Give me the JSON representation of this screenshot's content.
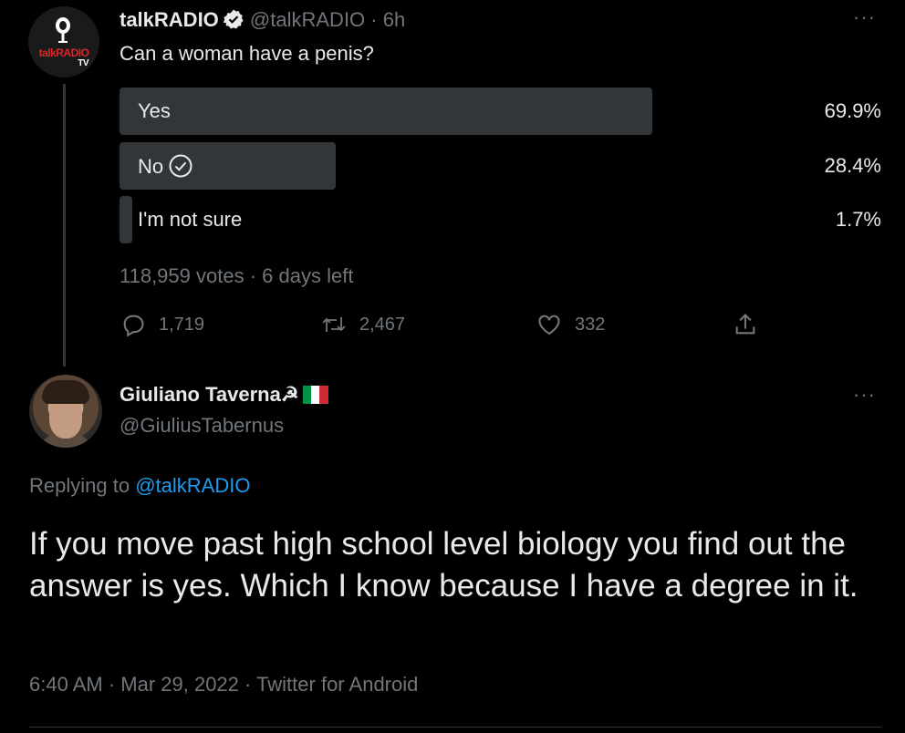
{
  "tweet": {
    "author_name": "talkRADIO",
    "handle": "@talkRADIO",
    "time": "· 6h",
    "avatar_brand": "talkRADIO",
    "avatar_brand_sub": "TV",
    "text": "Can a woman have a penis?",
    "more": "···",
    "poll": {
      "options": [
        {
          "label": "Yes",
          "percent_text": "69.9%",
          "percent": 69.9,
          "selected": false
        },
        {
          "label": "No",
          "percent_text": "28.4%",
          "percent": 28.4,
          "selected": true
        },
        {
          "label": "I'm not sure",
          "percent_text": "1.7%",
          "percent": 1.7,
          "selected": false
        }
      ],
      "votes_text": "118,959 votes",
      "time_left": "· 6 days left"
    },
    "actions": {
      "replies": "1,719",
      "retweets": "2,467",
      "likes": "332",
      "icons": [
        "reply-icon",
        "retweet-icon",
        "like-icon",
        "share-icon"
      ]
    }
  },
  "reply": {
    "author_name": "Giuliano Taverna☭",
    "handle": "@GiuliusTabernus",
    "more": "···",
    "replying_prefix": "Replying to",
    "replying_to": "@talkRADIO",
    "text": "If you move past high school level biology you find out the answer is yes. Which I know because I have a degree in it.",
    "timestamp": "6:40 AM · Mar 29, 2022 · Twitter for Android"
  },
  "colors": {
    "background": "#000000",
    "text": "#e7e9ea",
    "muted": "#71767b",
    "link": "#1d9bf0",
    "poll_bar": "#333639",
    "verified": "#e7e9ea",
    "flag": [
      "#009246",
      "#ffffff",
      "#ce2b37"
    ]
  }
}
